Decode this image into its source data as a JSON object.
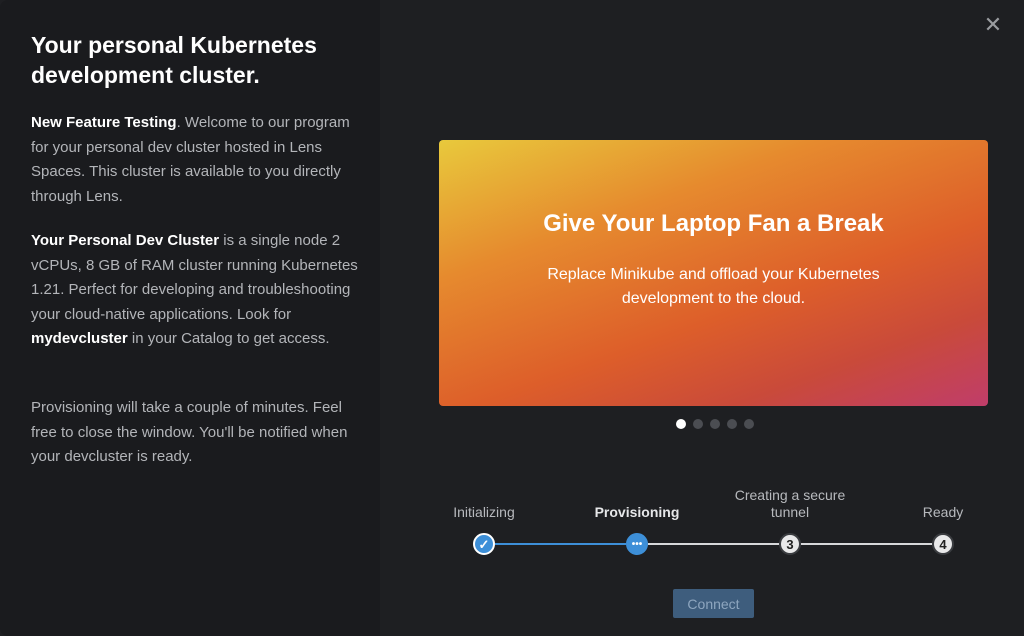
{
  "dialog": {
    "title": "Your personal Kubernetes development cluster.",
    "close_symbol": "✕",
    "p1_bold": "New Feature Testing",
    "p1_text": ". Welcome to our program for your personal dev cluster hosted in Lens Spaces. This cluster is available to you directly through Lens.",
    "p2_bold": "Your Personal Dev Cluster",
    "p2_text1": " is a single node 2 vCPUs, 8 GB of RAM cluster running Kubernetes 1.21. Perfect for developing and troubleshooting your cloud-native applications. Look for ",
    "p2_bold2": "mydevcluster",
    "p2_text2": " in your Catalog to get access.",
    "p3_text": "Provisioning will take a couple of minutes. Feel free to close the window. You'll be notified when your devcluster is ready."
  },
  "banner": {
    "title": "Give Your Laptop Fan a Break",
    "subtitle": "Replace Minikube and offload your Kubernetes development to the cloud.",
    "slide_count": 5,
    "active_slide": 1
  },
  "steps": [
    {
      "label": "Initializing",
      "status": "done",
      "marker": "✓"
    },
    {
      "label": "Provisioning",
      "status": "active",
      "marker": "•••"
    },
    {
      "label": "Creating a secure tunnel",
      "status": "pending",
      "marker": "3"
    },
    {
      "label": "Ready",
      "status": "pending",
      "marker": "4"
    }
  ],
  "connect_label": "Connect",
  "colors": {
    "accent": "#3d8fd8",
    "background": "#1e1f22",
    "connect_disabled": "#3e5d7d"
  }
}
